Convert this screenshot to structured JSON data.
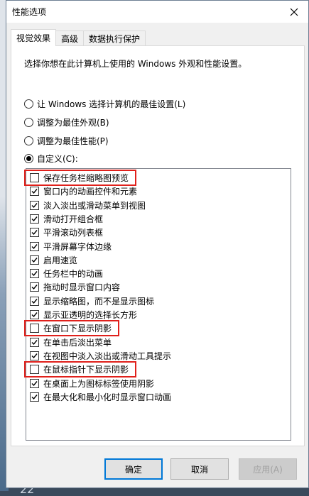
{
  "window": {
    "title": "性能选项"
  },
  "tabs": [
    {
      "label": "视觉效果",
      "active": true
    },
    {
      "label": "高级",
      "active": false
    },
    {
      "label": "数据执行保护",
      "active": false
    }
  ],
  "description": "选择你想在此计算机上使用的 Windows 外观和性能设置。",
  "radios": [
    {
      "label": "让 Windows 选择计算机的最佳设置(L)",
      "selected": false
    },
    {
      "label": "调整为最佳外观(B)",
      "selected": false
    },
    {
      "label": "调整为最佳性能(P)",
      "selected": false
    },
    {
      "label": "自定义(C):",
      "selected": true
    }
  ],
  "options": [
    {
      "label": "保存任务栏缩略图预览",
      "checked": false,
      "highlighted": true
    },
    {
      "label": "窗口内的动画控件和元素",
      "checked": true,
      "highlighted": false
    },
    {
      "label": "淡入淡出或滑动菜单到视图",
      "checked": true,
      "highlighted": false
    },
    {
      "label": "滑动打开组合框",
      "checked": true,
      "highlighted": false
    },
    {
      "label": "平滑滚动列表框",
      "checked": true,
      "highlighted": false
    },
    {
      "label": "平滑屏幕字体边缘",
      "checked": true,
      "highlighted": false
    },
    {
      "label": "启用速览",
      "checked": true,
      "highlighted": false
    },
    {
      "label": "任务栏中的动画",
      "checked": true,
      "highlighted": false
    },
    {
      "label": "拖动时显示窗口内容",
      "checked": true,
      "highlighted": false
    },
    {
      "label": "显示缩略图，而不是显示图标",
      "checked": true,
      "highlighted": false
    },
    {
      "label": "显示亚透明的选择长方形",
      "checked": true,
      "highlighted": false
    },
    {
      "label": "在窗口下显示阴影",
      "checked": false,
      "highlighted": true
    },
    {
      "label": "在单击后淡出菜单",
      "checked": true,
      "highlighted": false
    },
    {
      "label": "在视图中淡入淡出或滑动工具提示",
      "checked": true,
      "highlighted": false
    },
    {
      "label": "在鼠标指针下显示阴影",
      "checked": false,
      "highlighted": true
    },
    {
      "label": "在桌面上为图标标签使用阴影",
      "checked": true,
      "highlighted": false
    },
    {
      "label": "在最大化和最小化时显示窗口动画",
      "checked": true,
      "highlighted": false
    }
  ],
  "buttons": {
    "ok": "确定",
    "cancel": "取消",
    "apply": "应用(A)"
  },
  "background": {
    "bottom_text": "22"
  },
  "colors": {
    "highlight": "#e0201b",
    "accent": "#0078d7"
  }
}
